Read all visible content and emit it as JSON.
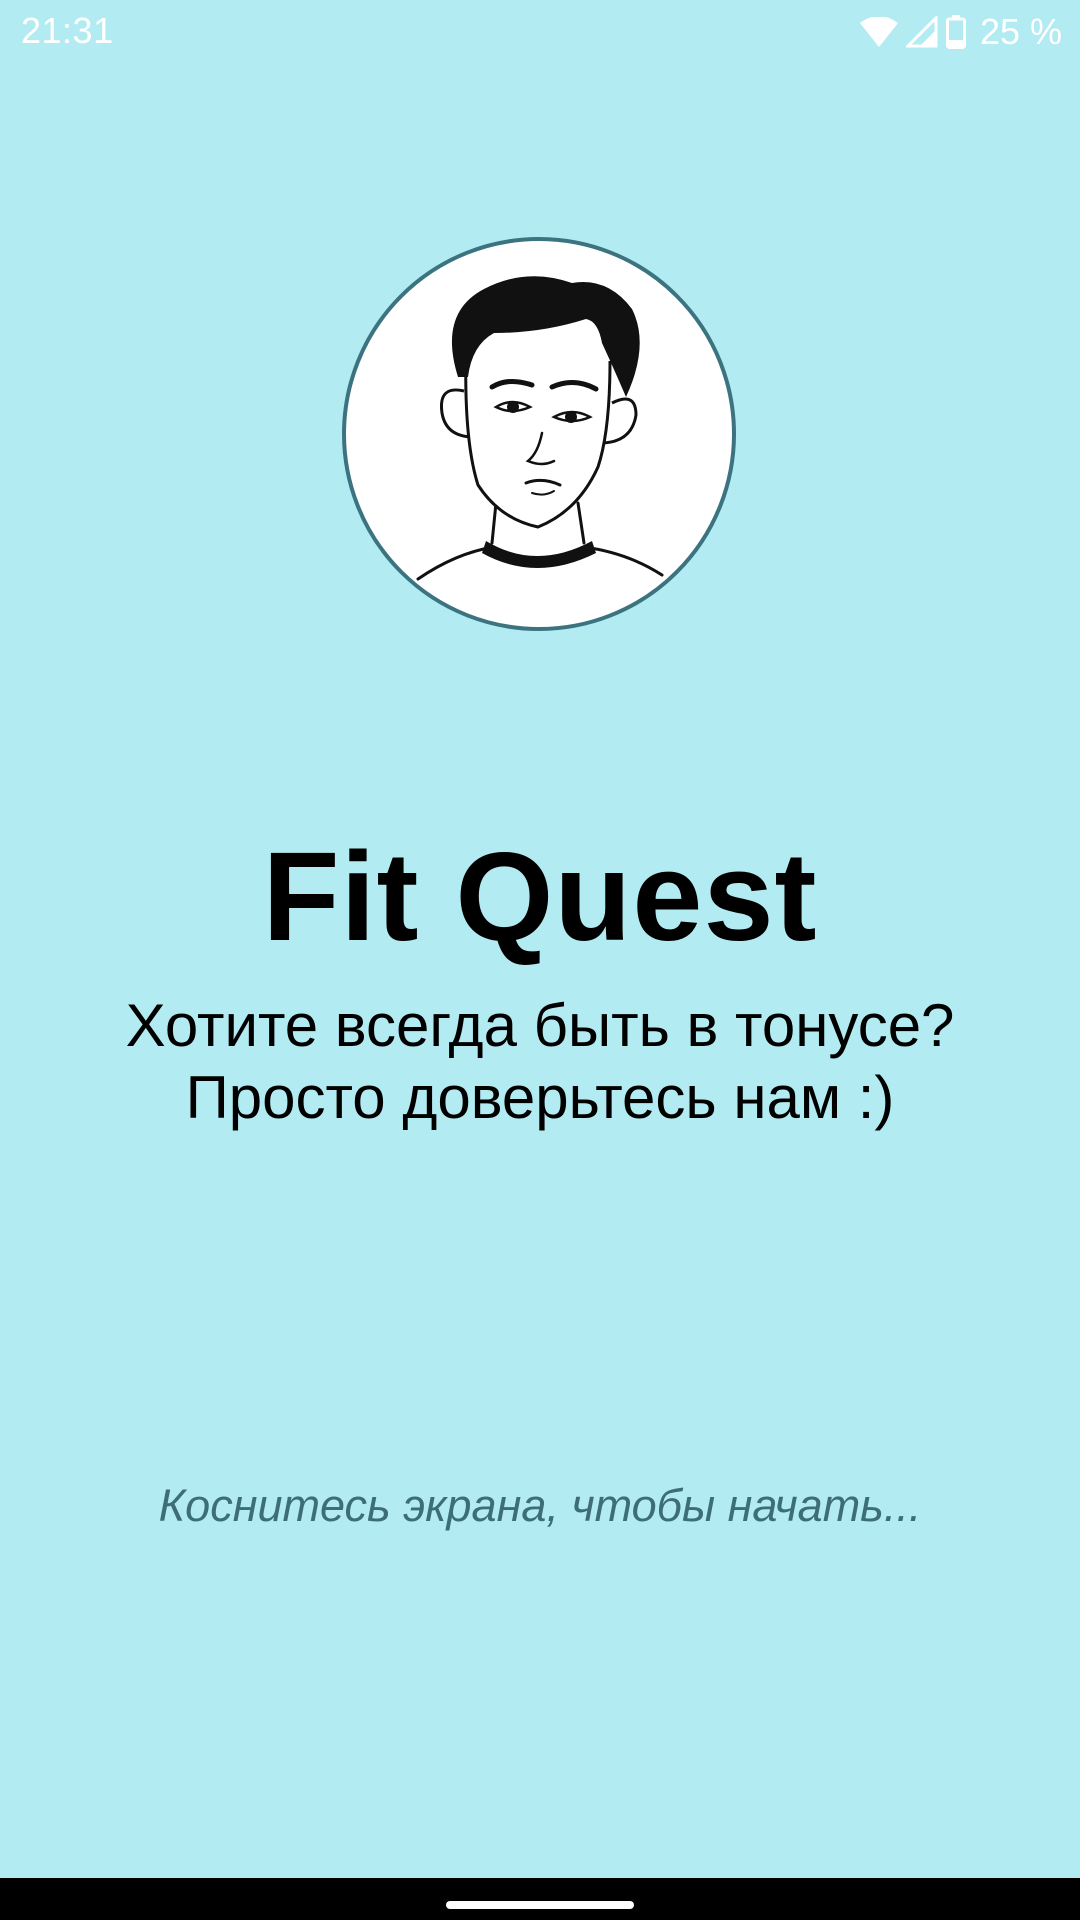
{
  "status_bar": {
    "time": "21:31",
    "battery_percent": "25 %",
    "icons": [
      "wifi-icon",
      "cell-signal-icon",
      "battery-icon"
    ],
    "battery_level": 0.25
  },
  "welcome": {
    "avatar_icon": "person-portrait-illustration",
    "title": "Fit Quest",
    "subtitle_line1": "Хотите всегда быть в тонусе?",
    "subtitle_line2": "Просто доверьтесь нам :)",
    "tap_hint": "Коснитесь экрана, чтобы начать..."
  },
  "colors": {
    "background": "#b3ebf2",
    "avatar_border": "#3b7480",
    "hint_text": "#3d6e78",
    "title_text": "#000000"
  },
  "nav_bar": {
    "home_indicator": "home-pill-icon"
  }
}
